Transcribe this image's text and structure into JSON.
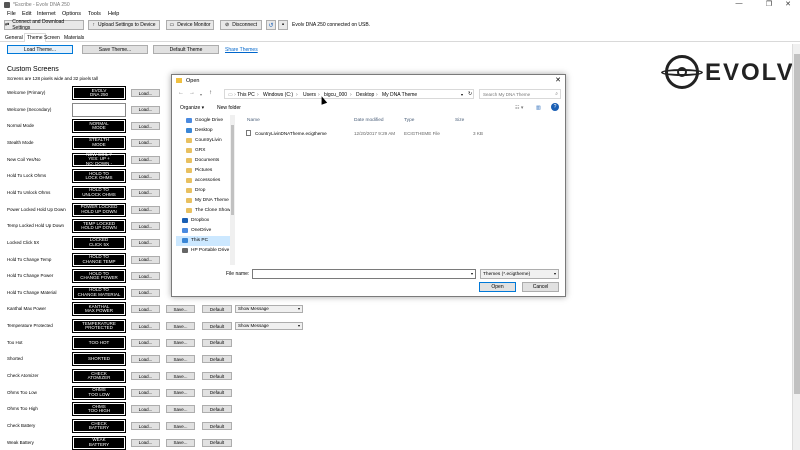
{
  "window": {
    "title": "*Escribe - Evolv DNA 250",
    "controls": [
      "—",
      "❐",
      "✕"
    ]
  },
  "menu": [
    "File",
    "Edit",
    "Internet",
    "Options",
    "Tools",
    "Help"
  ],
  "toolbar": {
    "connect_label": "Connect and Download Settings",
    "upload_label": "Upload Settings to Device",
    "monitor_label": "Device Monitor",
    "disconnect_label": "Disconnect",
    "status": "Evolv DNA 250 connected on USB."
  },
  "tabs": [
    "General",
    "Theme",
    "Screen",
    "Materials"
  ],
  "theme_bar": {
    "load": "Load Theme...",
    "save": "Save Theme...",
    "default": "Default Theme",
    "share": "Share Themes"
  },
  "custom_screens": {
    "title": "Custom Screens",
    "subtitle": "Screens are 128 pixels wide and 32 pixels tall",
    "load_label": "Load...",
    "save_label": "Save...",
    "default_label": "Default",
    "rows": [
      {
        "label": "Welcome (Primary)",
        "screen": "EVOLV\nDNA 250",
        "buttons": [
          "Load..."
        ],
        "select": ""
      },
      {
        "label": "Welcome (Secondary)",
        "screen": "",
        "buttons": [
          "Load..."
        ],
        "select": ""
      },
      {
        "label": "Normal Mode",
        "screen": "NORMAL\nMODE",
        "buttons": [
          "Load..."
        ],
        "select": ""
      },
      {
        "label": "Stealth Mode",
        "screen": "STEALTH\nMODE",
        "buttons": [
          "Load..."
        ],
        "select": ""
      },
      {
        "label": "New Coil Yes/No",
        "screen": "NEW COIL ?\nYES: UP +\nNO: DOWN -",
        "buttons": [
          "Load..."
        ],
        "select": ""
      },
      {
        "label": "Hold To Lock Ohms",
        "screen": "HOLD TO\nLOCK OHMS",
        "buttons": [
          "Load..."
        ],
        "select": ""
      },
      {
        "label": "Hold To Unlock Ohms",
        "screen": "HOLD TO\nUNLOCK OHMS",
        "buttons": [
          "Load..."
        ],
        "select": ""
      },
      {
        "label": "Power Locked Hold Up Down",
        "screen": "POWER LOCKED\nHOLD UP DOWN",
        "buttons": [
          "Load..."
        ],
        "select": ""
      },
      {
        "label": "Temp Locked Hold Up Down",
        "screen": "TEMP LOCKED\nHOLD UP DOWN",
        "buttons": [
          "Load..."
        ],
        "select": ""
      },
      {
        "label": "Locked Click 5X",
        "screen": "LOCKED\nCLICK 5X",
        "buttons": [
          "Load..."
        ],
        "select": ""
      },
      {
        "label": "Hold To Change Temp",
        "screen": "HOLD TO\nCHANGE TEMP",
        "buttons": [
          "Load..."
        ],
        "select": ""
      },
      {
        "label": "Hold To Change Power",
        "screen": "HOLD TO\nCHANGE POWER",
        "buttons": [
          "Load..."
        ],
        "select": ""
      },
      {
        "label": "Hold To Change Material",
        "screen": "HOLD TO\nCHANGE MATERIAL",
        "buttons": [
          "Load..."
        ],
        "select": ""
      },
      {
        "label": "Kanthal Max Power",
        "screen": "KANTHAL\nMAX POWER",
        "buttons": [
          "Load...",
          "Save...",
          "Default"
        ],
        "select": "Show Message"
      },
      {
        "label": "Temperature Protected",
        "screen": "TEMPERATURE\nPROTECTED",
        "buttons": [
          "Load...",
          "Save...",
          "Default"
        ],
        "select": "Show Message"
      },
      {
        "label": "Too Hot",
        "screen": "TOO HOT",
        "buttons": [
          "Load...",
          "Save...",
          "Default"
        ],
        "select": ""
      },
      {
        "label": "Shorted",
        "screen": "SHORTED",
        "buttons": [
          "Load...",
          "Save...",
          "Default"
        ],
        "select": ""
      },
      {
        "label": "Check Atomizer",
        "screen": "CHECK\nATOMIZER",
        "buttons": [
          "Load...",
          "Save...",
          "Default"
        ],
        "select": ""
      },
      {
        "label": "Ohms Too Low",
        "screen": "OHMS\nTOO LOW",
        "buttons": [
          "Load...",
          "Save...",
          "Default"
        ],
        "select": ""
      },
      {
        "label": "Ohms Too High",
        "screen": "OHMS\nTOO HIGH",
        "buttons": [
          "Load...",
          "Save...",
          "Default"
        ],
        "select": ""
      },
      {
        "label": "Check Battery",
        "screen": "CHECK\nBATTERY",
        "buttons": [
          "Load...",
          "Save...",
          "Default"
        ],
        "select": ""
      },
      {
        "label": "Weak Battery",
        "screen": "WEAK\nBATTERY",
        "buttons": [
          "Load...",
          "Save...",
          "Default"
        ],
        "select": ""
      }
    ]
  },
  "logo": {
    "word": "EVOLV"
  },
  "dialog": {
    "title": "Open",
    "breadcrumbs": [
      "This PC",
      "Windows (C:)",
      "Users",
      "bigcu_000",
      "Desktop",
      "My DNA Theme"
    ],
    "search_placeholder": "Search My DNA Theme",
    "organize": "Organize ▾",
    "new_folder": "New folder",
    "nav_items": [
      {
        "label": "Google Drive",
        "kind": "cloud"
      },
      {
        "label": "Desktop",
        "kind": "folder-blue"
      },
      {
        "label": "CountryLivin",
        "kind": "folder"
      },
      {
        "label": "GRX",
        "kind": "folder"
      },
      {
        "label": "Documents",
        "kind": "folder"
      },
      {
        "label": "Pictures",
        "kind": "folder"
      },
      {
        "label": "accessories",
        "kind": "folder"
      },
      {
        "label": "Drop",
        "kind": "folder"
      },
      {
        "label": "My DNA Theme",
        "kind": "folder"
      },
      {
        "label": "The Clone Show",
        "kind": "folder"
      },
      {
        "label": "Dropbox",
        "kind": "dropbox"
      },
      {
        "label": "OneDrive",
        "kind": "cloud"
      },
      {
        "label": "This PC",
        "kind": "pc"
      },
      {
        "label": "HP Portable Drive",
        "kind": "drive"
      }
    ],
    "columns": [
      "Name",
      "Date modified",
      "Type",
      "Size"
    ],
    "files": [
      {
        "name": "CountryLivinDNATheme.ecigtheme",
        "date": "12/20/2017 9:29 AM",
        "type": "ECIGTHEME File",
        "size": "3 KB"
      }
    ],
    "file_name_label": "File name:",
    "file_name_value": "",
    "file_type": "Themes (*.ecigtheme)",
    "open_label": "Open",
    "cancel_label": "Cancel"
  },
  "colors": {
    "accent": "#0078d7",
    "screen_bg": "#000000",
    "link": "#0066cc"
  }
}
